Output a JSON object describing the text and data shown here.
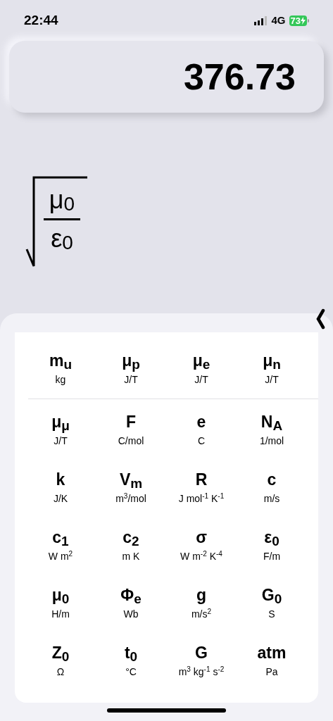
{
  "status_bar": {
    "time": "22:44",
    "network": "4G",
    "battery": "73"
  },
  "display": {
    "value": "376.73"
  },
  "formula": {
    "kind": "sqrt_fraction",
    "numerator": "μ$_{0}$",
    "denominator": "ε$_{0}$"
  },
  "constants": {
    "sections": [
      {
        "rows": [
          [
            {
              "symbol": "m$_{u}$",
              "unit": "kg"
            },
            {
              "symbol": "μ$_{p}$",
              "unit": "J/T"
            },
            {
              "symbol": "μ$_{e}$",
              "unit": "J/T"
            },
            {
              "symbol": "μ$_{n}$",
              "unit": "J/T"
            }
          ]
        ]
      },
      {
        "rows": [
          [
            {
              "symbol": "μ$_{μ}$",
              "unit": "J/T"
            },
            {
              "symbol": "F",
              "unit": "C/mol"
            },
            {
              "symbol": "e",
              "unit": "C"
            },
            {
              "symbol": "N$_{A}$",
              "unit": "1/mol"
            }
          ],
          [
            {
              "symbol": "k",
              "unit": "J/K"
            },
            {
              "symbol": "V$_{m}$",
              "unit": "m$^{3}$/mol"
            },
            {
              "symbol": "R",
              "unit": "J mol$^{-1}$ K$^{-1}$"
            },
            {
              "symbol": "c",
              "unit": "m/s"
            }
          ],
          [
            {
              "symbol": "c$_{1}$",
              "unit": "W m$^{2}$"
            },
            {
              "symbol": "c$_{2}$",
              "unit": "m K"
            },
            {
              "symbol": "σ",
              "unit": "W m$^{-2}$ K$^{-4}$"
            },
            {
              "symbol": "ε$_{0}$",
              "unit": "F/m"
            }
          ],
          [
            {
              "symbol": "μ$_{0}$",
              "unit": "H/m"
            },
            {
              "symbol": "Φ$_{e}$",
              "unit": "Wb"
            },
            {
              "symbol": "g",
              "unit": "m/s$^{2}$"
            },
            {
              "symbol": "G$_{0}$",
              "unit": "S"
            }
          ],
          [
            {
              "symbol": "Z$_{0}$",
              "unit": "Ω"
            },
            {
              "symbol": "t$_{0}$",
              "unit": "°C"
            },
            {
              "symbol": "G",
              "unit": "m$^{3}$ kg$^{-1}$ s$^{-2}$"
            },
            {
              "symbol": "atm",
              "unit": "Pa"
            }
          ]
        ]
      }
    ]
  }
}
